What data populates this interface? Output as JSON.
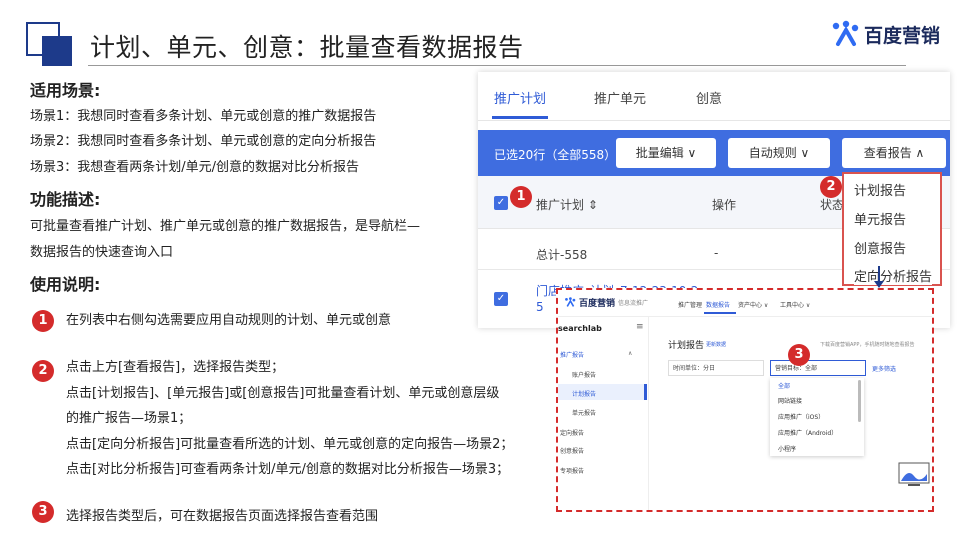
{
  "header": {
    "title": "计划、单元、创意：批量查看数据报告",
    "logo_text": "百度营销"
  },
  "sections": {
    "scenes_heading": "适用场景:",
    "scenes": [
      "场景1：我想同时查看多条计划、单元或创意的推广数据报告",
      "场景2：我想同时查看多条计划、单元或创意的定向分析报告",
      "场景3：我想查看两条计划/单元/创意的数据对比分析报告"
    ],
    "func_heading": "功能描述:",
    "func_lines": [
      "可批量查看推广计划、推广单元或创意的推广数据报告，是导航栏—",
      "数据报告的快速查询入口"
    ],
    "usage_heading": "使用说明:",
    "steps": [
      {
        "num": "1",
        "lines": [
          "在列表中右侧勾选需要应用自动规则的计划、单元或创意"
        ]
      },
      {
        "num": "2",
        "lines": [
          "点击上方[查看报告]，选择报告类型；",
          "点击[计划报告]、[单元报告]或[创意报告]可批量查看计划、单元或创意层级",
          "的推广报告—场景1；",
          "点击[定向分析报告]可批量查看所选的计划、单元或创意的定向报告—场景2；",
          "点击[对比分析报告]可查看两条计划/单元/创意的数据对比分析报告—场景3；"
        ]
      },
      {
        "num": "3",
        "lines": [
          "选择报告类型后，可在数据报告页面选择报告查看范围"
        ]
      }
    ]
  },
  "screenshot1": {
    "tabs": [
      "推广计划",
      "推广单元",
      "创意"
    ],
    "selected_text": "已选20行（全部558）",
    "buttons": [
      "批量编辑 ∨",
      "自动规则 ∨",
      "查看报告 ∧"
    ],
    "col_plan": "推广计划 ⇕",
    "col_op": "操作",
    "col_status": "状态",
    "total_label": "总计-558",
    "total_dash": "-",
    "row2_plan": "门店推广_计划_7-12-23-10-2",
    "row2_plan_line2": "5",
    "row2_dash": "-",
    "badge1": "1",
    "badge2": "2",
    "dropdown": [
      "计划报告",
      "单元报告",
      "创意报告"
    ],
    "dropdown_extra": "定向分析报告"
  },
  "screenshot2": {
    "brand": "百度营销",
    "brand_sub": "信息流推广",
    "nav": [
      "推广管理",
      "数据报告",
      "资产中心 ∨",
      "工具中心 ∨"
    ],
    "account": "searchlab",
    "sidebar": [
      {
        "label": "推广报告",
        "group": true,
        "expanded": true
      },
      {
        "label": "账户报告",
        "group": false
      },
      {
        "label": "计划报告",
        "group": false,
        "active": true
      },
      {
        "label": "单元报告",
        "group": false
      },
      {
        "label": "定向报告",
        "group": true
      },
      {
        "label": "创意报告",
        "group": true
      },
      {
        "label": "专项报告",
        "group": true
      }
    ],
    "page_title": "计划报告",
    "page_sub": "更新数据",
    "promo": "下载百度营销APP，手机随时随地查看报告",
    "time_unit": "时间单位：分日",
    "target_label": "营销目标：全部",
    "more_filter": "更多筛选",
    "badge3": "3",
    "options": [
      "全部",
      "网站链接",
      "应用推广（iOS）",
      "应用推广（Android）",
      "小程序"
    ]
  },
  "colors": {
    "brand_blue": "#3f6de0",
    "navy": "#1d3a8a",
    "badge_red": "#d42b2b"
  }
}
